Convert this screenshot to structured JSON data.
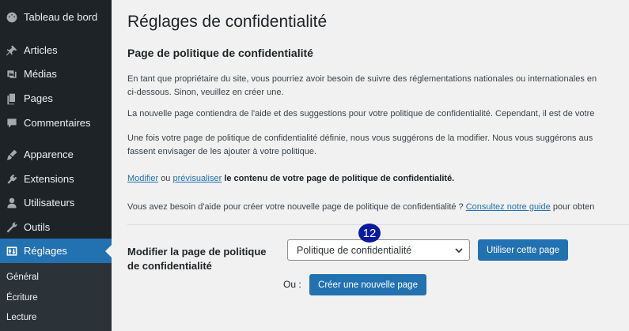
{
  "sidebar": {
    "items": [
      {
        "label": "Tableau de bord",
        "icon": "dashboard-icon"
      },
      {
        "label": "Articles",
        "icon": "pin-icon"
      },
      {
        "label": "Médias",
        "icon": "media-icon"
      },
      {
        "label": "Pages",
        "icon": "pages-icon"
      },
      {
        "label": "Commentaires",
        "icon": "comments-icon"
      },
      {
        "label": "Apparence",
        "icon": "appearance-icon"
      },
      {
        "label": "Extensions",
        "icon": "plugins-icon"
      },
      {
        "label": "Utilisateurs",
        "icon": "users-icon"
      },
      {
        "label": "Outils",
        "icon": "tools-icon"
      },
      {
        "label": "Réglages",
        "icon": "settings-icon"
      }
    ],
    "submenu": [
      "Général",
      "Écriture",
      "Lecture"
    ]
  },
  "main": {
    "page_title": "Réglages de confidentialité",
    "section_title": "Page de politique de confidentialité",
    "para1_line1": "En tant que propriétaire du site, vous pourriez avoir besoin de suivre des réglementations nationales ou internationales en",
    "para1_line2": "ci-dessous. Sinon, veuillez en créer une.",
    "para2": "La nouvelle page contiendra de l'aide et des suggestions pour votre politique de confidentialité. Cependant, il est de votre",
    "para3_line1": "Une fois votre page de politique de confidentialité définie, nous vous suggérons de la modifier. Nous vous suggérons aus",
    "para3_line2": "fassent envisager de les ajouter à votre politique.",
    "edit_link": "Modifier",
    "or_word": "ou",
    "preview_link": "prévisualiser",
    "edit_rest": "le contenu de votre page de politique de confidentialité.",
    "help_text": "Vous avez besoin d'aide pour créer votre nouvelle page de politique de confidentialité ?",
    "guide_link": "Consultez notre guide",
    "help_rest": "pour obten",
    "form_label": "Modifier la page de politique de confidentialité",
    "select_value": "Politique de confidentialité",
    "use_button": "Utiliser cette page",
    "or_label": "Ou :",
    "create_button": "Créer une nouvelle page",
    "badge": "12"
  },
  "colors": {
    "sidebar_bg": "#1d2327",
    "accent": "#2271b1",
    "badge": "#0a1a9e"
  }
}
